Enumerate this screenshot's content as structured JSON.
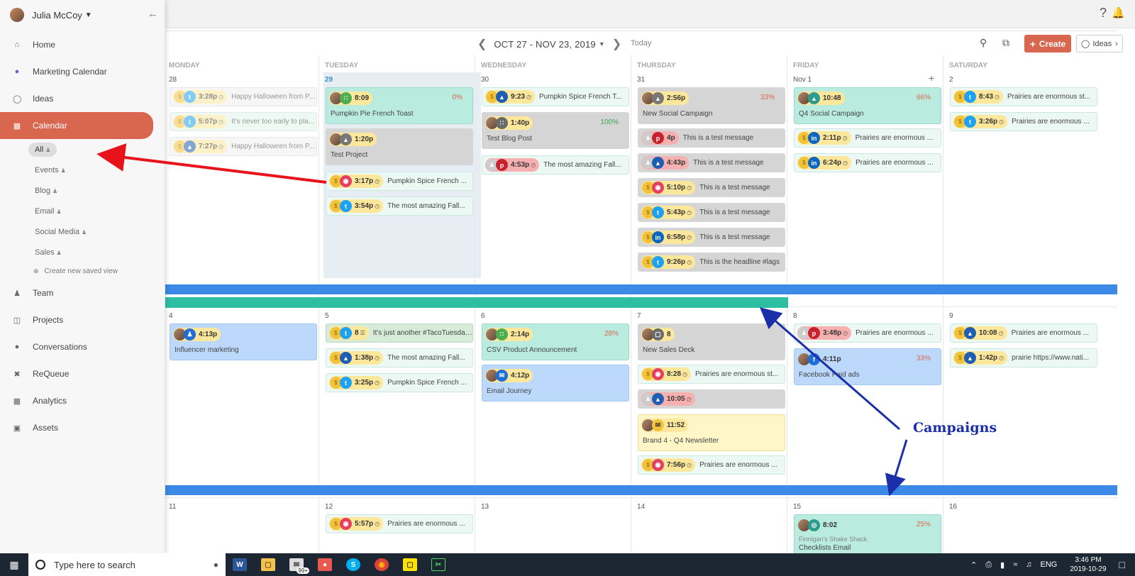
{
  "user": {
    "name": "Julia McCoy"
  },
  "nav": [
    {
      "label": "Home",
      "icon": "home-icon"
    },
    {
      "label": "Marketing Calendar",
      "icon": "circle-icon"
    },
    {
      "label": "Ideas",
      "icon": "lightbulb-icon"
    },
    {
      "label": "Calendar",
      "icon": "calendar-icon",
      "active": true
    },
    {
      "label": "Team",
      "icon": "team-icon"
    },
    {
      "label": "Projects",
      "icon": "projects-icon"
    },
    {
      "label": "Conversations",
      "icon": "chat-icon"
    },
    {
      "label": "ReQueue",
      "icon": "shuffle-icon"
    },
    {
      "label": "Analytics",
      "icon": "bar-chart-icon"
    },
    {
      "label": "Assets",
      "icon": "briefcase-icon"
    }
  ],
  "saved_views": [
    "All",
    "Events",
    "Blog",
    "Email",
    "Social Media",
    "Sales"
  ],
  "create_view": "Create new saved view",
  "toolbar": {
    "range": "OCT 27 - NOV 23, 2019",
    "today": "Today",
    "create": "Create",
    "ideas": "Ideas"
  },
  "days": [
    "MONDAY",
    "TUESDAY",
    "WEDNESDAY",
    "THURSDAY",
    "FRIDAY",
    "SATURDAY"
  ],
  "week1": [
    "28",
    "29",
    "30",
    "31",
    "Nov 1",
    "2"
  ],
  "week2": [
    "4",
    "5",
    "6",
    "7",
    "8",
    "9"
  ],
  "week3": [
    "11",
    "12",
    "13",
    "14",
    "15",
    "16"
  ],
  "events": {
    "mon28_1": {
      "time": "3:28p",
      "text": "Happy Halloween from P..."
    },
    "mon28_2": {
      "time": "5:07p",
      "text": "It's never too early to pla..."
    },
    "mon28_3": {
      "time": "7:27p",
      "text": "Happy Halloween from P..."
    },
    "tue29_1": {
      "time": "8:09",
      "pct": "0%",
      "text": "Pumpkin Pie French Toast"
    },
    "tue29_2": {
      "time": "1:20p",
      "text": "Test Project"
    },
    "tue29_3": {
      "time": "3:17p",
      "text": "Pumpkin Spice French ..."
    },
    "tue29_4": {
      "time": "3:54p",
      "text": "The most amazing Fall..."
    },
    "wed30_1": {
      "time": "9:23",
      "text": "Pumpkin Spice French T..."
    },
    "wed30_2": {
      "time": "1:40p",
      "pct": "100%",
      "text": "Test Blog Post"
    },
    "wed30_3": {
      "time": "4:53p",
      "text": "The most amazing Fall..."
    },
    "thu31_1": {
      "time": "2:56p",
      "pct": "33%",
      "text": "New Social Campaign"
    },
    "thu31_2": {
      "time": "4p",
      "text": "This is a test message"
    },
    "thu31_3": {
      "time": "4:43p",
      "text": "This is a test message"
    },
    "thu31_4": {
      "time": "5:10p",
      "text": "This is a test message"
    },
    "thu31_5": {
      "time": "5:43p",
      "text": "This is a test message"
    },
    "thu31_6": {
      "time": "6:58p",
      "text": "This is a test message"
    },
    "thu31_7": {
      "time": "9:26p",
      "text": "This is the headline #lags"
    },
    "fri1_1": {
      "time": "10:48",
      "pct": "66%",
      "text": "Q4 Social Campaign"
    },
    "fri1_2": {
      "time": "2:11p",
      "text": "Prairies are enormous ..."
    },
    "fri1_3": {
      "time": "6:24p",
      "text": "Prairies are enormous ..."
    },
    "sat2_1": {
      "time": "8:43",
      "text": "Prairies are enormous st..."
    },
    "sat2_2": {
      "time": "3:26p",
      "text": "Prairies are enormous ..."
    },
    "mon4_1": {
      "time": "4:13p",
      "text": "Influencer marketing"
    },
    "tue5_1": {
      "time": "8",
      "text": "It's just another #TacoTuesday..."
    },
    "tue5_2": {
      "time": "1:38p",
      "text": "The most amazing Fall..."
    },
    "tue5_3": {
      "time": "3:25p",
      "text": "Pumpkin Spice French ..."
    },
    "wed6_1": {
      "time": "2:14p",
      "pct": "28%",
      "text": "CSV Product Announcement"
    },
    "wed6_2": {
      "time": "4:12p",
      "text": "Email Journey"
    },
    "thu7_1": {
      "time": "8",
      "text": "New Sales Deck"
    },
    "thu7_2": {
      "time": "8:28",
      "text": "Prairies are enormous st..."
    },
    "thu7_3": {
      "time": "10:05"
    },
    "thu7_4": {
      "time": "11:52",
      "text": "Brand 4 - Q4 Newsletter"
    },
    "thu7_5": {
      "time": "7:56p",
      "text": "Prairies are enormous ..."
    },
    "fri8_1": {
      "time": "3:48p",
      "text": "Prairies are enormous ..."
    },
    "fri8_2": {
      "time": "4:11p",
      "pct": "33%",
      "text": "Facebook Paid ads"
    },
    "sat9_1": {
      "time": "10:08",
      "text": "Prairies are enormous ..."
    },
    "sat9_2": {
      "time": "1:42p",
      "text": "prairie https://www.nati..."
    },
    "tue12_1": {
      "time": "5:57p",
      "text": "Prairies are enormous ..."
    },
    "fri15_1": {
      "time": "8:02",
      "pct": "25%",
      "sub": "Finnigan's Shake Shack",
      "text": "Checklists Email"
    }
  },
  "callout": "Campaigns",
  "taskbar": {
    "search": "Type here to search",
    "badge": "99+",
    "lang": "ENG",
    "time": "3:46 PM",
    "date": "2019-10-29"
  },
  "colors": {
    "accent": "#d9664f",
    "campaign_band": "#3c89e8",
    "teal_band": "#2ebfa2",
    "red_arrow": "#e8121b",
    "blue_arrow": "#1a2fa8"
  }
}
